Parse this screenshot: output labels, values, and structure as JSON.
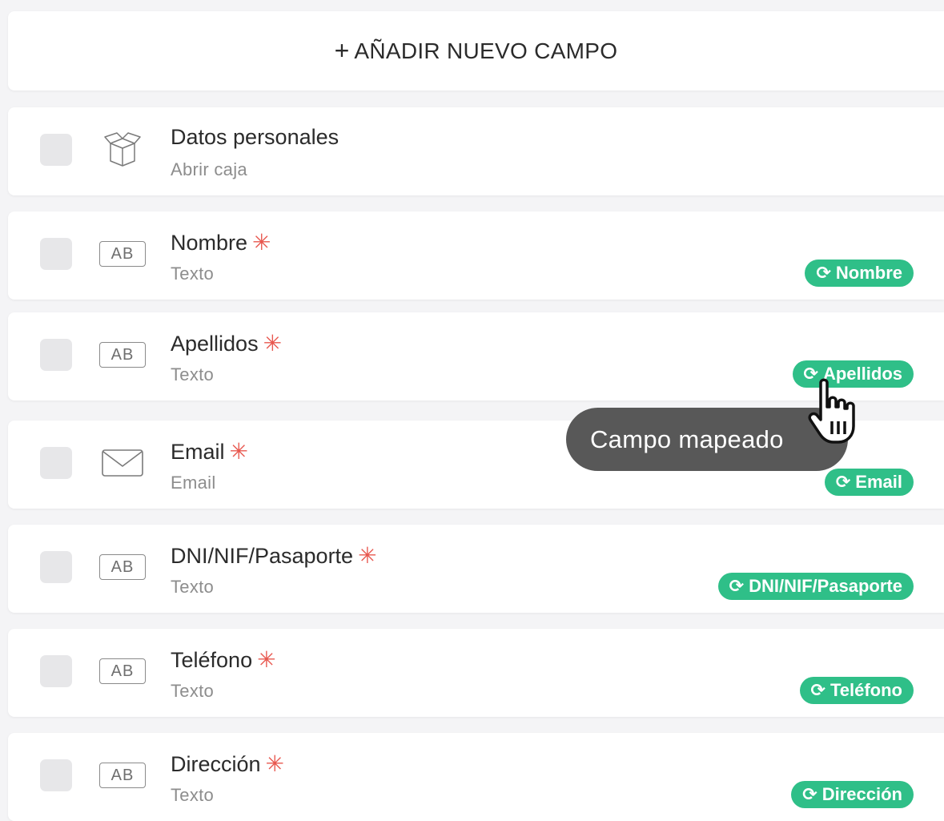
{
  "add_field": {
    "plus": "+",
    "label": "AÑADIR NUEVO CAMPO"
  },
  "rows": [
    {
      "title": "Datos personales",
      "subtitle": "Abrir caja",
      "icon": "box-icon",
      "required": false,
      "badge": null
    },
    {
      "title": "Nombre",
      "subtitle": "Texto",
      "icon": "text-field-icon",
      "required": true,
      "badge": "Nombre"
    },
    {
      "title": "Apellidos",
      "subtitle": "Texto",
      "icon": "text-field-icon",
      "required": true,
      "badge": "Apellidos"
    },
    {
      "title": "Email",
      "subtitle": "Email",
      "icon": "envelope-icon",
      "required": true,
      "badge": "Email"
    },
    {
      "title": "DNI/NIF/Pasaporte",
      "subtitle": "Texto",
      "icon": "text-field-icon",
      "required": true,
      "badge": "DNI/NIF/Pasaporte"
    },
    {
      "title": "Teléfono",
      "subtitle": "Texto",
      "icon": "text-field-icon",
      "required": true,
      "badge": "Teléfono"
    },
    {
      "title": "Dirección",
      "subtitle": "Texto",
      "icon": "text-field-icon",
      "required": true,
      "badge": "Dirección"
    }
  ],
  "text_icon_label": "AB",
  "required_mark": "✳",
  "sync_icon": "sync-icon",
  "tooltip": "Campo mapeado",
  "colors": {
    "badge": "#2fbf88",
    "required": "#e8584f",
    "tooltip": "#585858"
  }
}
